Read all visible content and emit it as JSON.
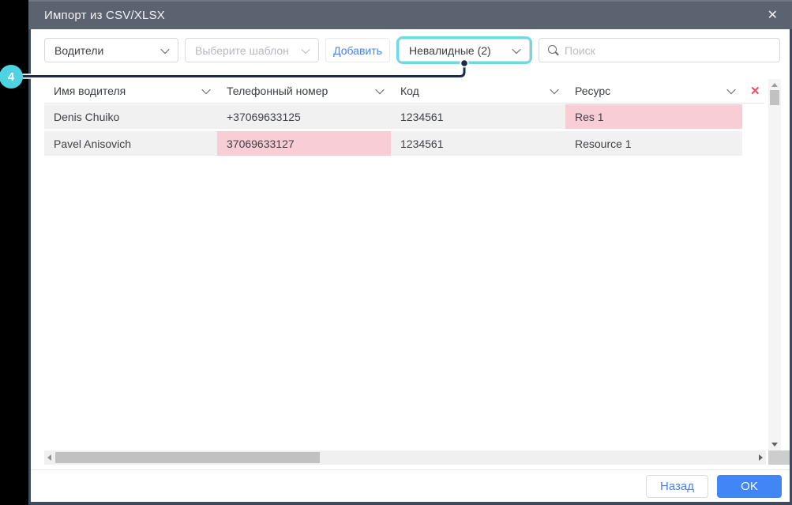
{
  "window": {
    "title": "Импорт из CSV/XLSX",
    "close_icon": "✕"
  },
  "toolbar": {
    "entity_select": "Водители",
    "template_select": "Выберите шаблон",
    "add_button": "Добавить",
    "validity_filter": "Невалидные (2)",
    "search_placeholder": "Поиск"
  },
  "callout": {
    "number": "4"
  },
  "table": {
    "delete_icon": "✕",
    "columns": [
      {
        "label": "Имя водителя"
      },
      {
        "label": "Телефонный номер"
      },
      {
        "label": "Код"
      },
      {
        "label": "Ресурс"
      }
    ],
    "rows": [
      {
        "cells": [
          {
            "text": "Denis Chuiko",
            "invalid": false
          },
          {
            "text": "+37069633125",
            "invalid": false
          },
          {
            "text": "1234561",
            "invalid": false
          },
          {
            "text": "Res 1",
            "invalid": true
          }
        ]
      },
      {
        "cells": [
          {
            "text": "Pavel Anisovich",
            "invalid": false
          },
          {
            "text": "37069633127",
            "invalid": true
          },
          {
            "text": "1234561",
            "invalid": false
          },
          {
            "text": "Resource 1",
            "invalid": false
          }
        ]
      }
    ]
  },
  "footer": {
    "back_button": "Назад",
    "ok_button": "OK"
  },
  "colors": {
    "titlebar": "#5b6370",
    "accent_blue": "#4285f4",
    "highlight_cyan": "#6fd8e6",
    "callout_cyan": "#4fd3e3",
    "callout_line": "#1c2b4a",
    "invalid_pink": "#f9cdd5",
    "delete_red": "#f5485e",
    "row_bg": "#f1f1f2",
    "modal_border": "#3d4a5e",
    "outside_bg": "#000000"
  }
}
